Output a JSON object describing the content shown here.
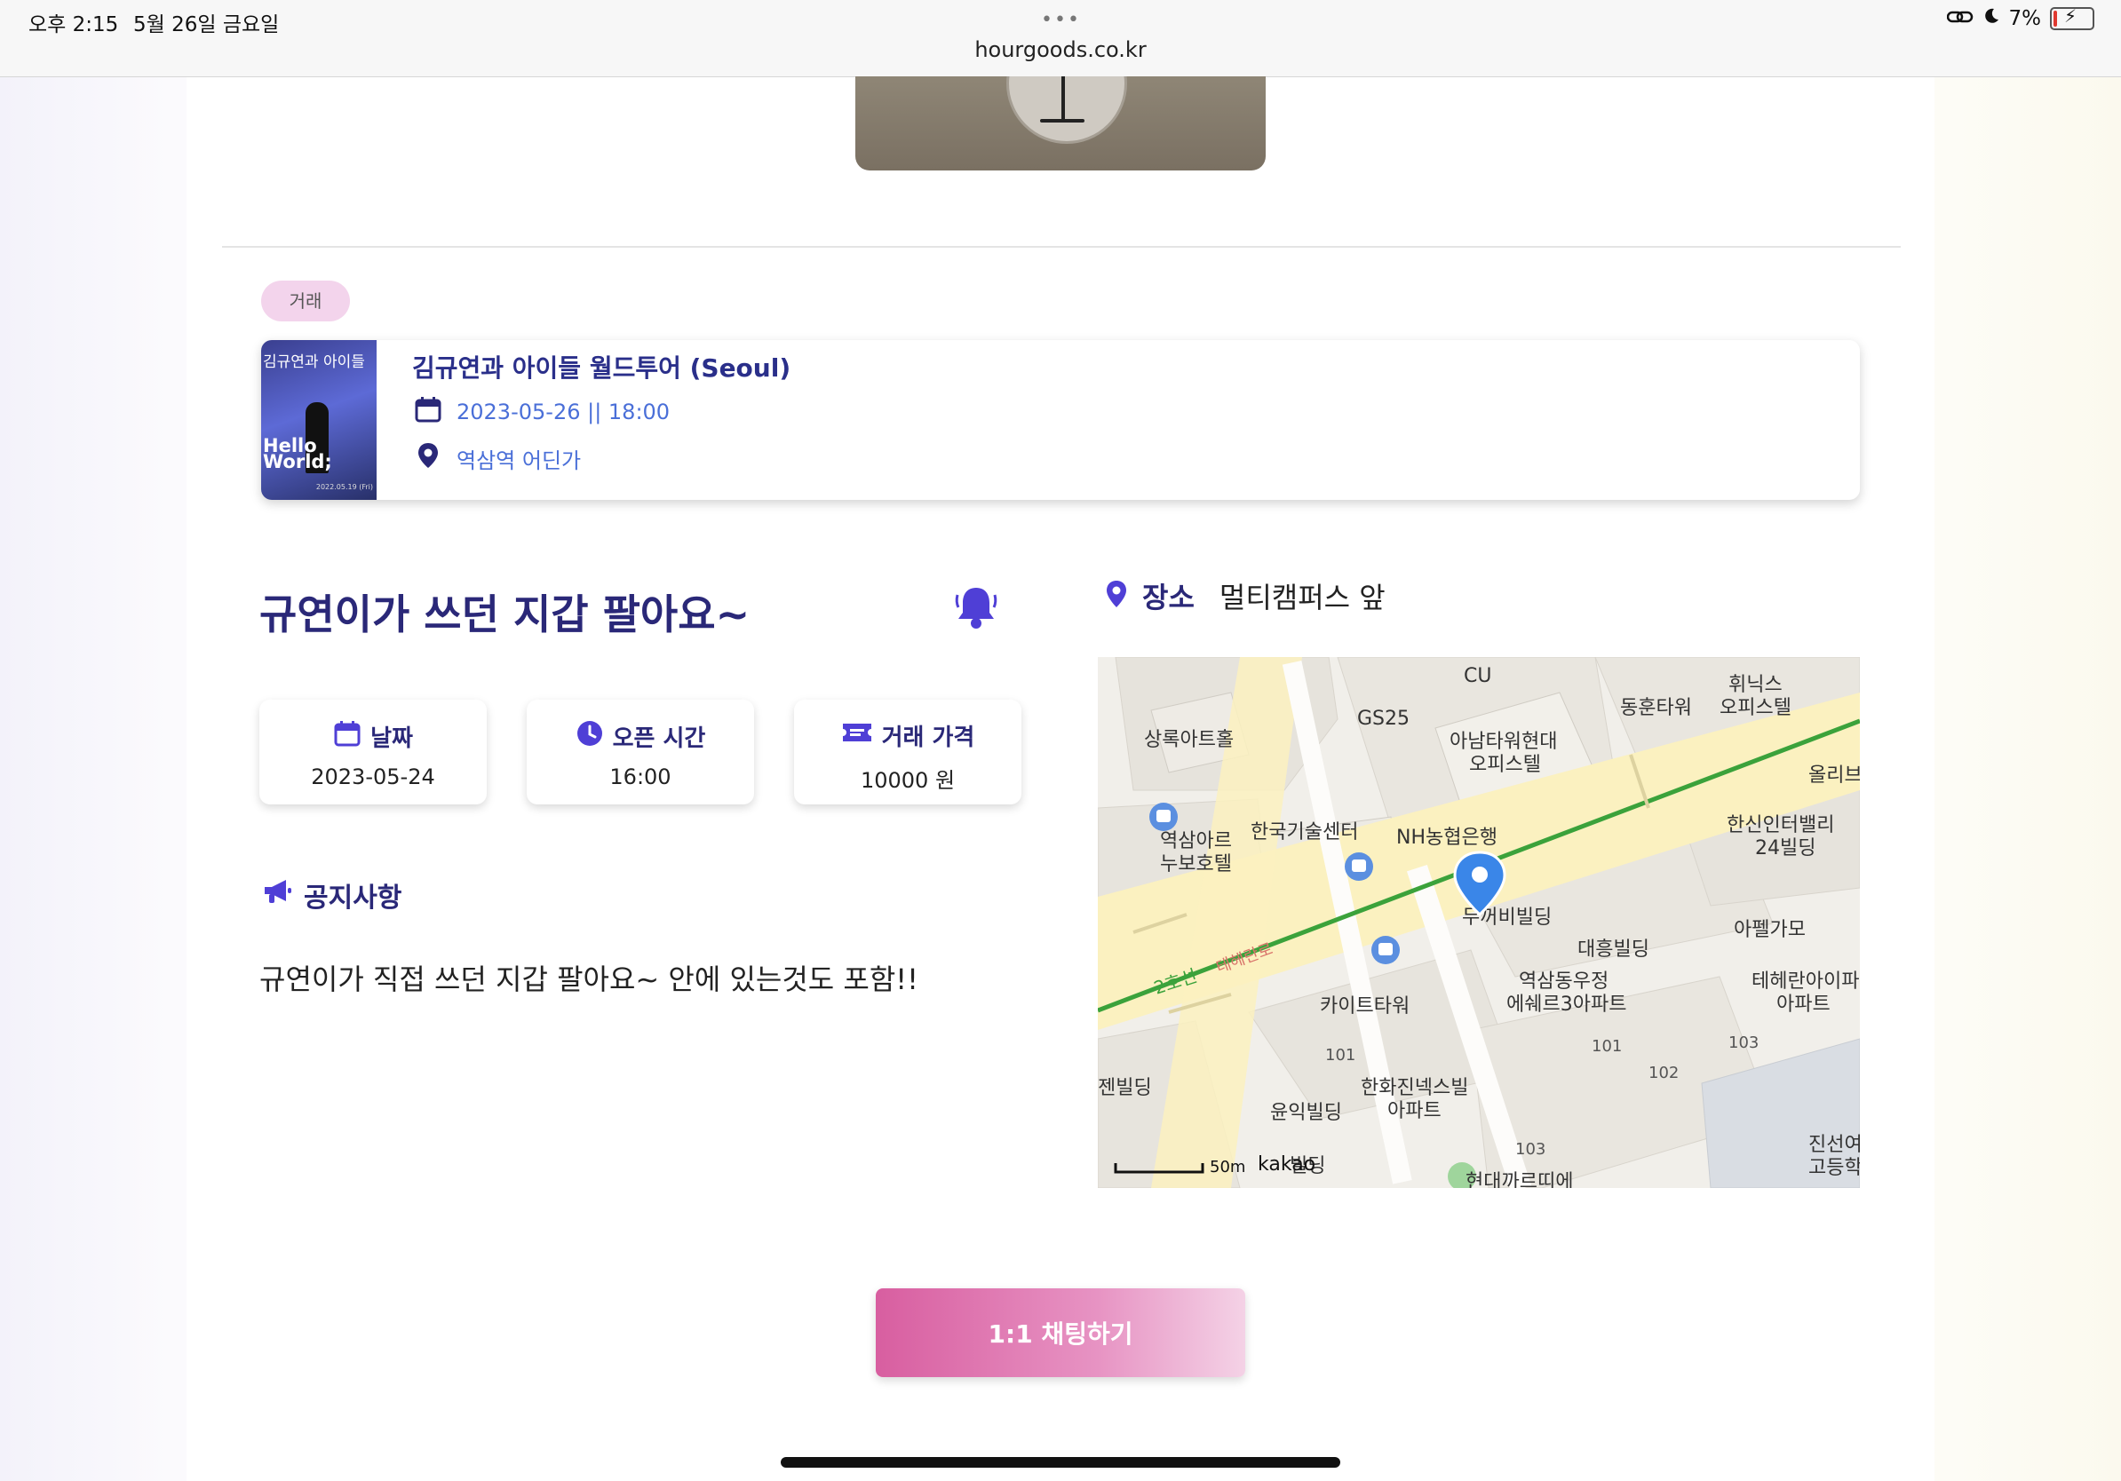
{
  "status_bar": {
    "time": "오후 2:15",
    "date": "5월 26일 금요일",
    "battery": "7%"
  },
  "browser": {
    "url": "hourgoods.co.kr"
  },
  "category_badge": "거래",
  "event": {
    "thumb_title": "김규연과 아이들",
    "thumb_hello": "Hello World;",
    "thumb_date": "2022.05.19 (Fri)",
    "title": "김규연과 아이들 월드투어 (Seoul)",
    "datetime": "2023-05-26 || 18:00",
    "location": "역삼역 어딘가"
  },
  "post": {
    "title": "규연이가 쓰던 지갑 팔아요~",
    "date_label": "날짜",
    "date_value": "2023-05-24",
    "open_label": "오픈 시간",
    "open_value": "16:00",
    "price_label": "거래 가격",
    "price_value": "10000 원",
    "notice_label": "공지사항",
    "notice_body": "규연이가 직접 쓰던 지갑 팔아요~ 안에 있는것도 포함!!"
  },
  "place": {
    "label": "장소",
    "value": "멀티캠퍼스 앞"
  },
  "map": {
    "labels": {
      "l1": "상록아트홀",
      "l2": "GS25",
      "l3": "CU",
      "l4": "아남타워현대",
      "l5": "오피스텔",
      "l6": "동훈타워",
      "l7": "휘닉스",
      "l8": "오피스텔",
      "l9": "올리브",
      "l10": "역삼아르",
      "l11": "누보호텔",
      "l12": "한국기술센터",
      "l13": "NH농협은행",
      "l14": "한신인터밸리",
      "l15": "24빌딩",
      "l16": "두꺼비빌딩",
      "l17": "아펠가모",
      "l18": "대흥빌딩",
      "l19": "역삼동우정",
      "l20": "에쉐르3아파트",
      "l21": "테헤란아이파",
      "l22": "아파트",
      "l23": "카이트타워",
      "l24": "젠빌딩",
      "l25": "한화진넥스빌",
      "l26": "아파트",
      "l27": "윤익빌딩",
      "l28": "진선여",
      "l29": "고등학",
      "l30": "빌딩",
      "l31": "현대까르띠에",
      "subway": "2호선",
      "road": "테헤란로",
      "n1": "101",
      "n2": "101",
      "n3": "102",
      "n4": "103",
      "n5": "103",
      "scale": "50m",
      "brand": "kakao"
    }
  },
  "chat_button": "1:1 채팅하기",
  "colors": {
    "primary": "#2a2878",
    "accent_blue": "#4a6fd8",
    "bell": "#4f3fd6",
    "badge_bg": "#f3d4ec",
    "button_start": "#d85ea0",
    "button_end": "#f4d2e6"
  }
}
